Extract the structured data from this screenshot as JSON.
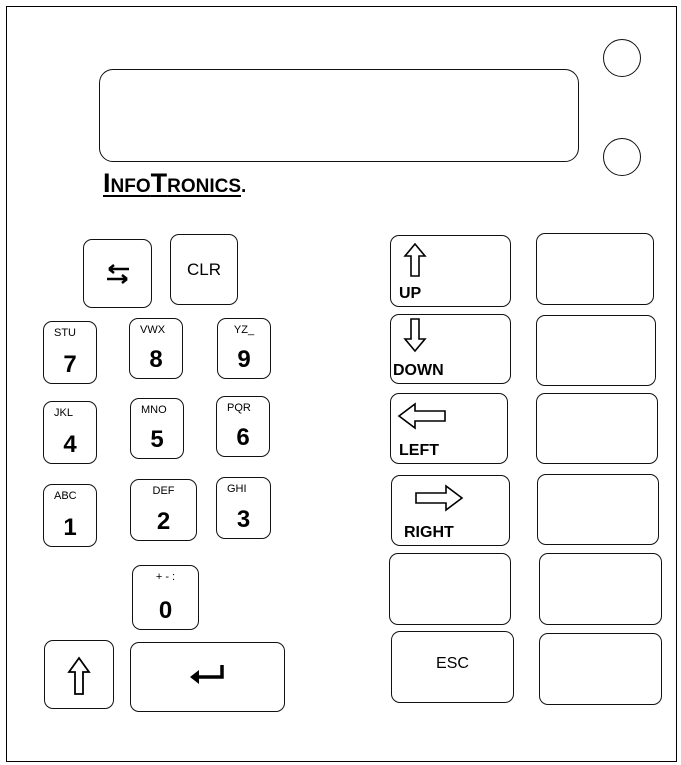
{
  "brand": {
    "text_big1": "I",
    "text_small1": "NFO",
    "text_big2": "T",
    "text_small2": "RONICS",
    "dot": "."
  },
  "keys": {
    "clr": "CLR",
    "esc": "ESC",
    "up": "UP",
    "down": "DOWN",
    "left": "LEFT",
    "right": "RIGHT",
    "k7": {
      "letters": "STU",
      "digit": "7"
    },
    "k8": {
      "letters": "VWX",
      "digit": "8"
    },
    "k9": {
      "letters": "YZ_",
      "digit": "9"
    },
    "k4": {
      "letters": "JKL",
      "digit": "4"
    },
    "k5": {
      "letters": "MNO",
      "digit": "5"
    },
    "k6": {
      "letters": "PQR",
      "digit": "6"
    },
    "k1": {
      "letters": "ABC",
      "digit": "1"
    },
    "k2": {
      "letters": "DEF",
      "digit": "2"
    },
    "k3": {
      "letters": "GHI",
      "digit": "3"
    },
    "k0": {
      "letters": "+ - :",
      "digit": "0"
    }
  },
  "icons": {
    "swap": "swap-arrows-icon",
    "shift": "shift-up-arrow-icon",
    "enter": "enter-return-icon",
    "up": "up-arrow-icon",
    "down": "down-arrow-icon",
    "left": "left-arrow-icon",
    "right": "right-arrow-icon"
  }
}
